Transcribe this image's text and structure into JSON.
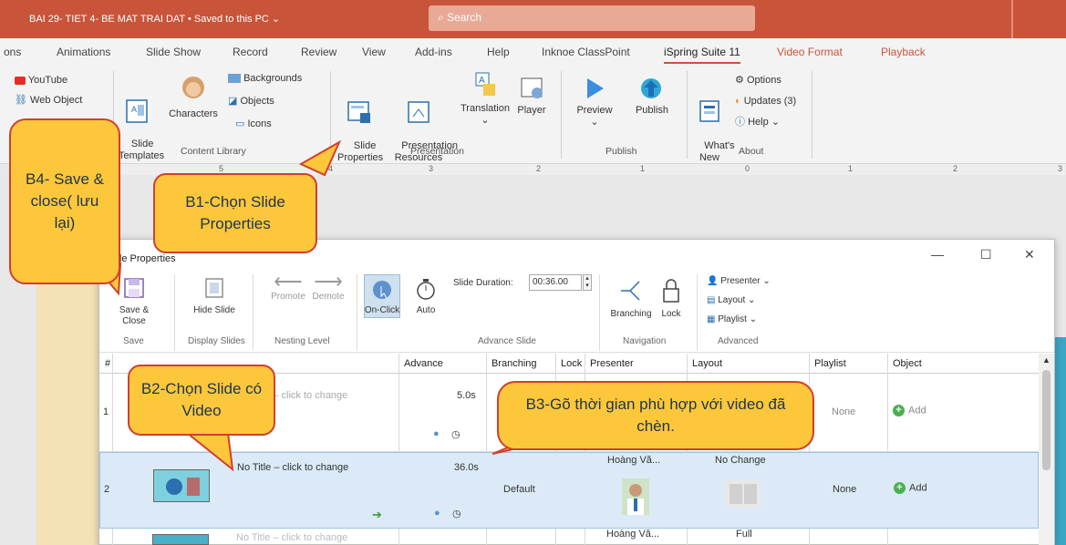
{
  "window": {
    "doc_title": "BAI 29- TIET 4- BE MAT TRAI DAT • Saved to this PC ⌄",
    "search": "Search"
  },
  "menu": [
    "ons",
    "Animations",
    "Slide Show",
    "Record",
    "Review",
    "View",
    "Add-ins",
    "Help",
    "Inknoe ClassPoint",
    "iSpring Suite 11",
    "Video Format",
    "Playback"
  ],
  "ribbon": {
    "youtube": "YouTube",
    "web_object": "Web Object",
    "slide_templates": "Slide\nTemplates",
    "characters": "Characters",
    "backgrounds": "Backgrounds",
    "objects": "Objects",
    "icons": "Icons",
    "content_library": "Content Library",
    "slide_properties": "Slide\nProperties",
    "presentation_resources": "Presentation\nResources",
    "translation": "Translation",
    "player": "Player",
    "presentation_group": "Presentation",
    "preview": "Preview",
    "publish": "Publish",
    "publish_group": "Publish",
    "whats_new": "What's\nNew",
    "options": "Options",
    "updates": "Updates (3)",
    "help": "Help ⌄",
    "about_group": "About"
  },
  "ruler": [
    "5",
    "4",
    "3",
    "2",
    "1",
    "0",
    "1",
    "2",
    "3"
  ],
  "dialog": {
    "title": "Slide Properties",
    "toolbar": {
      "save_close": "Save & Close",
      "save_group": "Save",
      "hide_slide": "Hide Slide",
      "display_group": "Display Slides",
      "promote": "Promote",
      "demote": "Demote",
      "nesting_group": "Nesting Level",
      "on_click": "On-Click",
      "auto": "Auto",
      "slide_duration_label": "Slide Duration:",
      "slide_duration_value": "00:36.00",
      "advance_group": "Advance Slide",
      "branching": "Branching",
      "lock": "Lock",
      "navigation_group": "Navigation",
      "presenter": "Presenter ⌄",
      "layout": "Layout ⌄",
      "playlist": "Playlist ⌄",
      "advanced_group": "Advanced"
    },
    "columns": [
      "#",
      "Advance",
      "Branching",
      "Lock",
      "Presenter",
      "Layout",
      "Playlist",
      "Object"
    ],
    "rows": [
      {
        "num": "1",
        "title": "No Title – click to change",
        "advance": "5.0s",
        "branching": "",
        "presenter": "",
        "layout": "",
        "playlist": "None",
        "object": "Add"
      },
      {
        "num": "2",
        "title": "No Title – click to change",
        "advance": "36.0s",
        "branching": "Default",
        "presenter": "Hoàng Vă...",
        "layout": "No Change",
        "playlist": "None",
        "object": "Add"
      },
      {
        "num": "",
        "title": "No Title – click to change",
        "advance": "",
        "branching": "",
        "presenter": "Hoàng Vă...",
        "layout": "Full",
        "playlist": "",
        "object": ""
      }
    ]
  },
  "callouts": {
    "b1": "B1-Chọn Slide Properties",
    "b2": "B2-Chọn Slide có Video",
    "b3": "B3-Gõ thời gian phù hợp với video đã chèn.",
    "b4": "B4- Save & close( lưu lại)"
  },
  "colors": {
    "title_bar": "#c8543a",
    "callout_fill": "#fcc73a",
    "callout_border": "#d23e2f",
    "selected_row": "#dbeaf6"
  }
}
